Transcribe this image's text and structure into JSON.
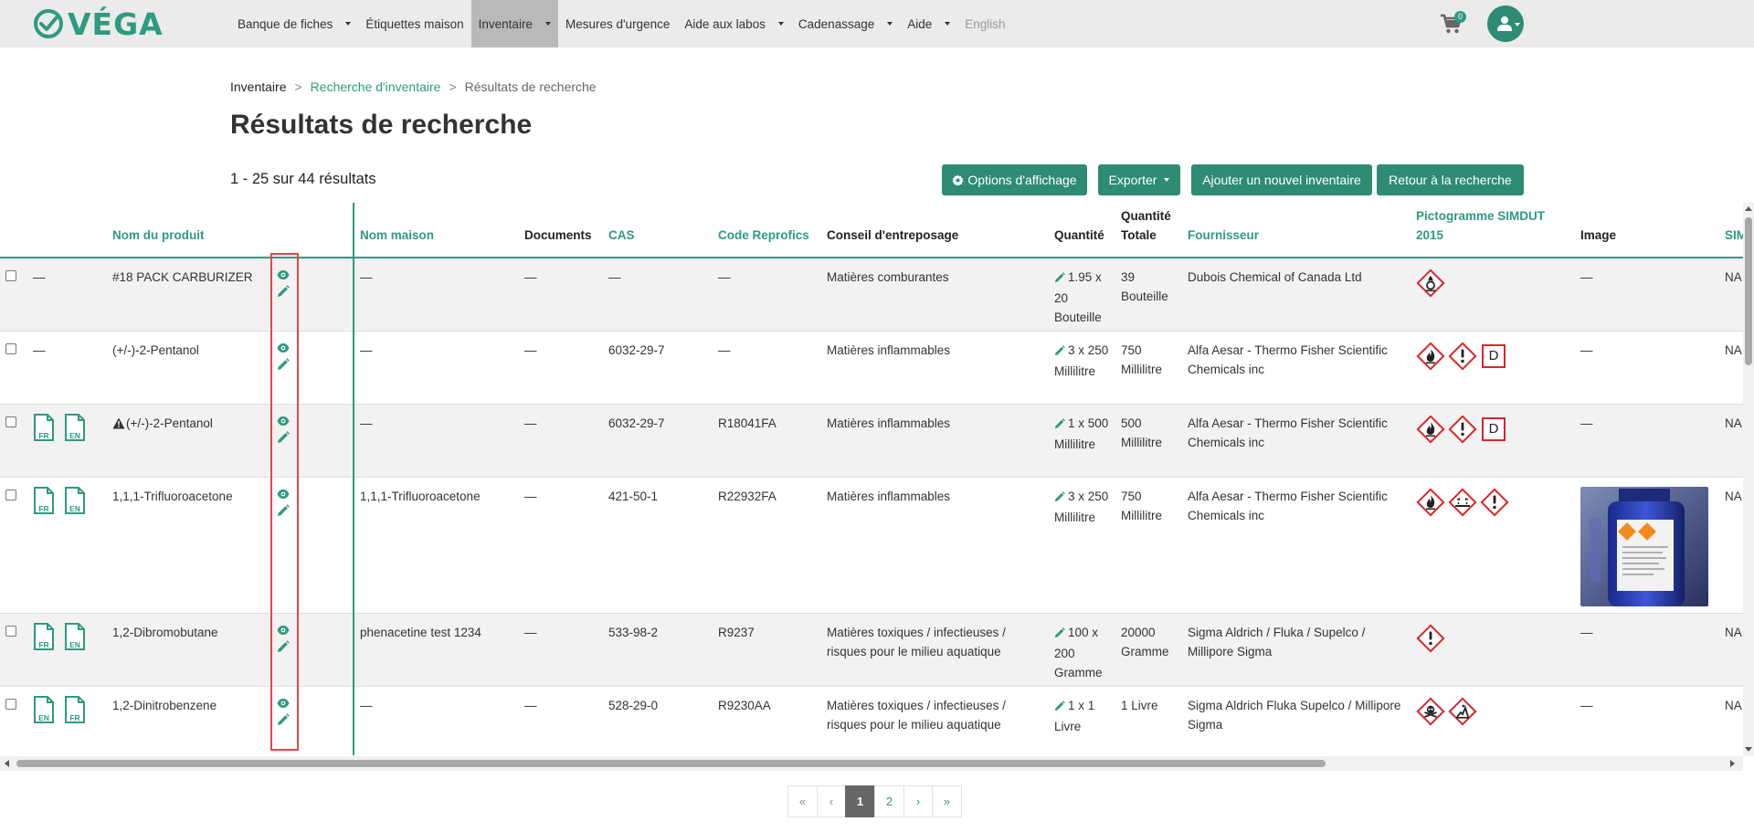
{
  "brand": {
    "logo_text": "VÉGA",
    "color": "#2e9a80"
  },
  "nav": {
    "items": [
      {
        "label": "Banque de fiches",
        "dropdown": true,
        "active": false
      },
      {
        "label": "Étiquettes maison",
        "dropdown": false,
        "active": false
      },
      {
        "label": "Inventaire",
        "dropdown": true,
        "active": true
      },
      {
        "label": "Mesures d'urgence",
        "dropdown": false,
        "active": false
      },
      {
        "label": "Aide aux labos",
        "dropdown": true,
        "active": false
      },
      {
        "label": "Cadenassage",
        "dropdown": true,
        "active": false
      },
      {
        "label": "Aide",
        "dropdown": true,
        "active": false
      },
      {
        "label": "English",
        "dropdown": false,
        "active": false
      }
    ],
    "cart_count": "0",
    "cart_icon": "cart-icon",
    "user_icon": "user-icon"
  },
  "breadcrumb": {
    "home": "Inventaire",
    "separator": ">",
    "search": "Recherche d'inventaire",
    "current": "Résultats de recherche"
  },
  "page": {
    "title": "Résultats de recherche",
    "result_count": "1 - 25 sur 44 résultats"
  },
  "toolbar": {
    "options_label": "Options d'affichage",
    "options_icon": "gear-icon",
    "export_label": "Exporter",
    "add_label": "Ajouter un nouvel inventaire",
    "back_label": "Retour à la recherche"
  },
  "table": {
    "headers": {
      "product": "Nom du produit",
      "house_name": "Nom maison",
      "documents": "Documents",
      "cas": "CAS",
      "code": "Code Reprofics",
      "storage": "Conseil d'entreposage",
      "quantity": "Quantité",
      "total_quantity": "Quantité Totale",
      "supplier": "Fournisseur",
      "pictogram": "Pictogramme SIMDUT 2015",
      "image": "Image",
      "simdut": "SIM"
    },
    "rows": [
      {
        "fiche": "—",
        "docs": [],
        "product": "#18 PACK CARBURIZER",
        "warning": false,
        "house_name": "—",
        "documents": "—",
        "cas": "—",
        "code": "—",
        "storage": "Matières comburantes",
        "quantity": "1.95 x 20 Bouteille",
        "total": "39 Bouteille",
        "supplier": "Dubois Chemical of Canada Ltd",
        "pictos": [
          "oxidizer-pictogram"
        ],
        "image": "—",
        "simdut": "NA"
      },
      {
        "fiche": "—",
        "docs": [],
        "product": "(+/-)-2-Pentanol",
        "warning": false,
        "house_name": "—",
        "documents": "—",
        "cas": "6032-29-7",
        "code": "—",
        "storage": "Matières inflammables",
        "quantity": "3 x 250 Millilitre",
        "total": "750 Millilitre",
        "supplier": "Alfa Aesar - Thermo Fisher Scientific Chemicals inc",
        "pictos": [
          "flame-pictogram",
          "exclamation-pictogram",
          "D"
        ],
        "image": "—",
        "simdut": "NA"
      },
      {
        "fiche": "",
        "docs": [
          "FR",
          "EN"
        ],
        "product": "(+/-)-2-Pentanol",
        "warning": true,
        "house_name": "—",
        "documents": "—",
        "cas": "6032-29-7",
        "code": "R18041FA",
        "storage": "Matières inflammables",
        "quantity": "1 x 500 Millilitre",
        "total": "500 Millilitre",
        "supplier": "Alfa Aesar - Thermo Fisher Scientific Chemicals inc",
        "pictos": [
          "flame-pictogram",
          "exclamation-pictogram",
          "D"
        ],
        "image": "—",
        "simdut": "NA"
      },
      {
        "fiche": "",
        "docs": [
          "FR",
          "EN"
        ],
        "product": "1,1,1-Trifluoroacetone",
        "warning": false,
        "house_name": "1,1,1-Trifluoroacetone",
        "documents": "—",
        "cas": "421-50-1",
        "code": "R22932FA",
        "storage": "Matières inflammables",
        "quantity": "3 x 250 Millilitre",
        "total": "750 Millilitre",
        "supplier": "Alfa Aesar - Thermo Fisher Scientific Chemicals inc",
        "pictos": [
          "flame-pictogram",
          "corrosion-pictogram",
          "exclamation-pictogram"
        ],
        "image": "product-photo",
        "simdut": "NA"
      },
      {
        "fiche": "",
        "docs": [
          "FR",
          "EN"
        ],
        "product": "1,2-Dibromobutane",
        "warning": false,
        "house_name": "phenacetine test 1234",
        "documents": "—",
        "cas": "533-98-2",
        "code": "R9237",
        "storage": "Matières toxiques / infectieuses / risques pour le milieu aquatique",
        "quantity": "100 x 200 Gramme",
        "total": "20000 Gramme",
        "supplier": "Sigma Aldrich / Fluka / Supelco / Millipore Sigma",
        "pictos": [
          "exclamation-pictogram"
        ],
        "image": "—",
        "simdut": "NA"
      },
      {
        "fiche": "",
        "docs": [
          "EN",
          "FR"
        ],
        "product": "1,2-Dinitrobenzene",
        "warning": false,
        "house_name": "—",
        "documents": "—",
        "cas": "528-29-0",
        "code": "R9230AA",
        "storage": "Matières toxiques / infectieuses / risques pour le milieu aquatique",
        "quantity": "1 x 1 Livre",
        "total": "1 Livre",
        "supplier": "Sigma Aldrich Fluka Supelco / Millipore Sigma",
        "pictos": [
          "skull-pictogram",
          "health-hazard-pictogram"
        ],
        "image": "—",
        "simdut": "NA"
      }
    ]
  },
  "pagination": {
    "first": "«",
    "prev": "‹",
    "pages": [
      "1",
      "2"
    ],
    "current": "1",
    "next": "›",
    "last": "»"
  },
  "colors": {
    "accent": "#2e9a80",
    "button": "#2e8b74",
    "nav_bg": "#ebebeb",
    "highlight": "#e04848",
    "pictogram_red": "#d9262a"
  }
}
